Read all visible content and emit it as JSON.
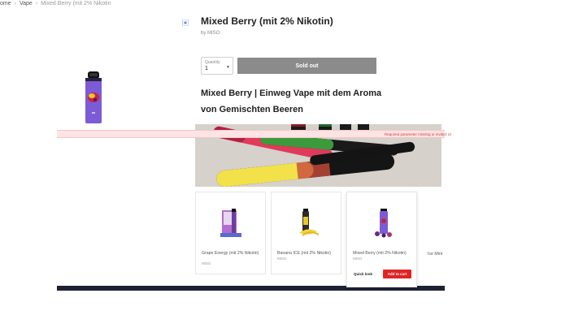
{
  "breadcrumb": {
    "home": "ome",
    "sep": "›",
    "category": "Vape",
    "current": "Mixed Berry (mit 2% Nikotin"
  },
  "product": {
    "title": "Mixed Berry (mit 2% Nikotin)",
    "vendor": "by MISO",
    "quantity_label": "Quantity",
    "quantity_value": "1",
    "sold_out_label": "Sold out",
    "heading": "Mixed Berry | Einweg Vape mit dem Aroma von Gemischten Beeren"
  },
  "error_message": "Required parameter missing or invalid: id",
  "related": [
    {
      "name": "Grape Energy (mit 2% Nikotin)",
      "brand": "MISO"
    },
    {
      "name": "Banana ICE (mit 2% Nikotin)",
      "brand": "MISO"
    },
    {
      "name": "Mixed Berry (mit 2% Nikotin)",
      "brand": "MISO",
      "quick_look": "Quick look",
      "add_to_cart": "Add to cart"
    },
    {
      "name": "Ice Mint"
    }
  ],
  "icons": [
    "zoom-icon",
    "chevron-down-icon"
  ],
  "colors": {
    "sold_out": "#8b8b8b",
    "add_to_cart": "#e02424",
    "error_bg": "#fde4e4",
    "error_text": "#d23a3a",
    "footer": "#1d2233",
    "device_purple": "#7b5bd6"
  }
}
